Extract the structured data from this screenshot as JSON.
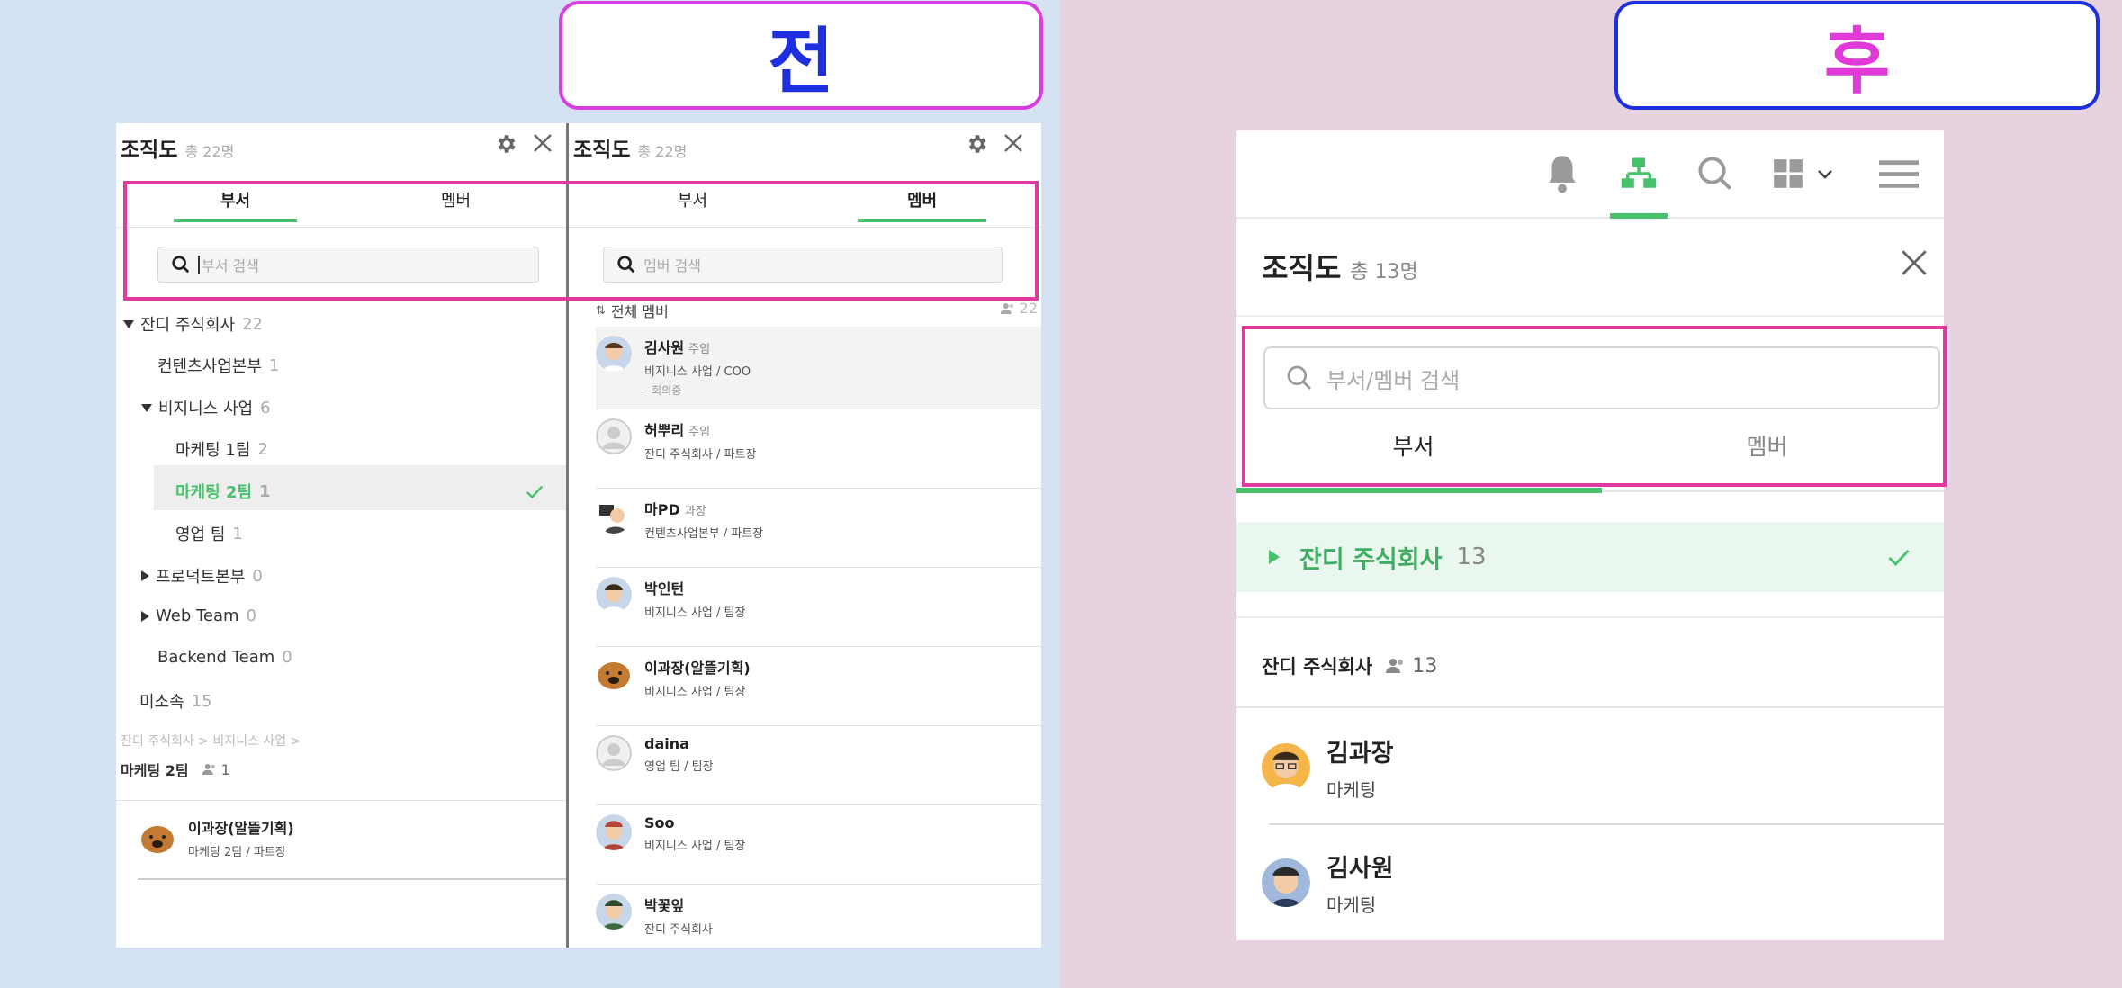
{
  "labels": {
    "before": "전",
    "after": "후"
  },
  "before_dept": {
    "title": "조직도",
    "count": "총 22명",
    "tabs": [
      "부서",
      "멤버"
    ],
    "search_placeholder": "부서 검색",
    "tree": [
      {
        "name": "잔디 주식회사",
        "count": "22"
      },
      {
        "name": "컨텐츠사업본부",
        "count": "1"
      },
      {
        "name": "비지니스 사업",
        "count": "6"
      },
      {
        "name": "마케팅 1팀",
        "count": "2"
      },
      {
        "name": "마케팅 2팀",
        "count": "1"
      },
      {
        "name": "영업 팀",
        "count": "1"
      },
      {
        "name": "프로덕트본부",
        "count": "0"
      },
      {
        "name": "Web Team",
        "count": "0"
      },
      {
        "name": "Backend Team",
        "count": "0"
      },
      {
        "name": "미소속",
        "count": "15"
      }
    ],
    "breadcrumb": "잔디 주식회사  >  비지니스 사업  >",
    "team_name": "마케팅 2팀",
    "team_count": "1",
    "team_member": {
      "name": "이과장(알뜰기획)",
      "sub": "마케팅 2팀 / 파트장"
    }
  },
  "before_member": {
    "title": "조직도",
    "count": "총 22명",
    "tabs": [
      "부서",
      "멤버"
    ],
    "search_placeholder": "멤버 검색",
    "all_label": "전체 멤버",
    "all_count": "22",
    "members": [
      {
        "name": "김사원",
        "pos": "주임",
        "sub": "비지니스 사업 / COO",
        "status": "- 회의중"
      },
      {
        "name": "허뿌리",
        "pos": "주임",
        "sub": "잔디 주식회사 / 파트장"
      },
      {
        "name": "마PD",
        "pos": "과장",
        "sub": "컨텐츠사업본부 / 파트장"
      },
      {
        "name": "박인턴",
        "pos": "",
        "sub": "비지니스 사업 / 팀장"
      },
      {
        "name": "이과장(알뜰기획)",
        "pos": "",
        "sub": "비지니스 사업 / 팀장"
      },
      {
        "name": "daina",
        "pos": "",
        "sub": "영업 팀 / 팀장"
      },
      {
        "name": "Soo",
        "pos": "",
        "sub": "비지니스 사업 / 팀장"
      },
      {
        "name": "박꽃잎",
        "pos": "",
        "sub": "잔디 주식회사"
      }
    ]
  },
  "after": {
    "title": "조직도",
    "count": "총 13명",
    "search_placeholder": "부서/멤버 검색",
    "tabs": [
      "부서",
      "멤버"
    ],
    "company": {
      "name": "잔디 주식회사",
      "count": "13"
    },
    "group": {
      "name": "잔디 주식회사",
      "count": "13"
    },
    "members": [
      {
        "name": "김과장",
        "sub": "마케팅"
      },
      {
        "name": "김사원",
        "sub": "마케팅"
      }
    ],
    "icons": [
      "bell-icon",
      "org-chart-icon",
      "search-icon",
      "grid-icon",
      "chevron-down-icon",
      "menu-icon"
    ]
  },
  "colors": {
    "accent": "#47c16b",
    "highlight": "#e03aa0",
    "before_label": "#1e2fe0",
    "after_label": "#e03ad9"
  }
}
